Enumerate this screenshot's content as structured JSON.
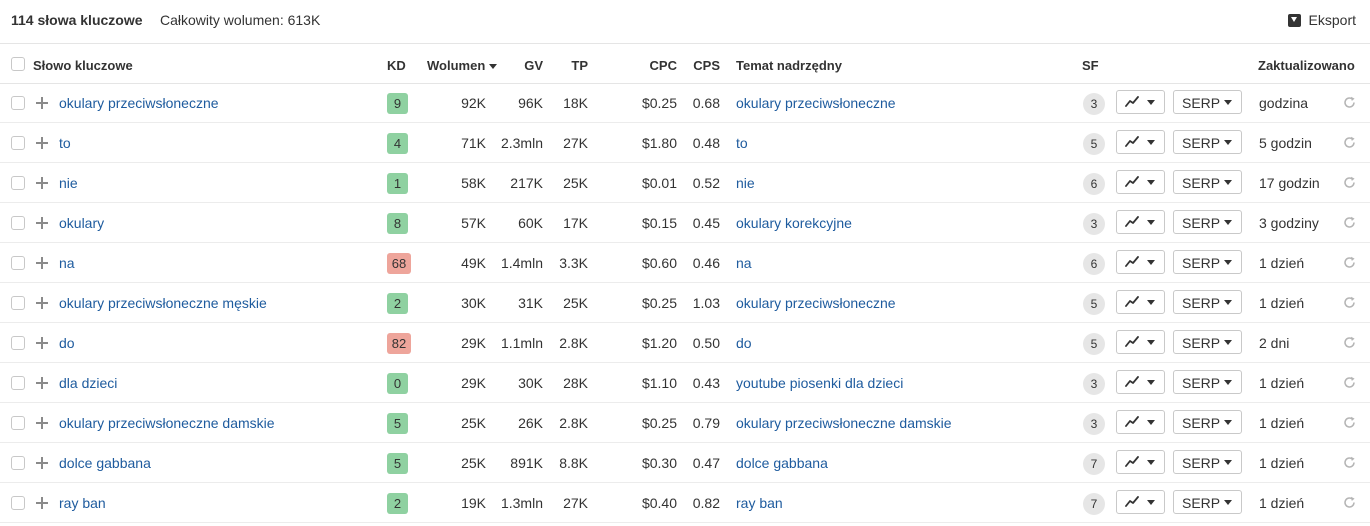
{
  "header": {
    "title": "114 słowa kluczowe",
    "volume": "Całkowity wolumen: 613K",
    "export_label": "Eksport"
  },
  "columns": {
    "keyword": "Słowo kluczowe",
    "kd": "KD",
    "volume": "Wolumen",
    "gv": "GV",
    "tp": "TP",
    "cpc": "CPC",
    "cps": "CPS",
    "parent": "Temat nadrzędny",
    "sf": "SF",
    "updated": "Zaktualizowano"
  },
  "serp_label": "SERP",
  "colors": {
    "link": "#1e5b9e",
    "kd_green": "#8fd1a1",
    "kd_red": "#eea59b"
  },
  "rows": [
    {
      "keyword": "okulary przeciwsłoneczne",
      "kd": "9",
      "kd_color": "green",
      "volume": "92K",
      "gv": "96K",
      "tp": "18K",
      "cpc": "$0.25",
      "cps": "0.68",
      "parent": "okulary przeciwsłoneczne",
      "sf": "3",
      "updated": "godzina"
    },
    {
      "keyword": "to",
      "kd": "4",
      "kd_color": "green",
      "volume": "71K",
      "gv": "2.3mln",
      "tp": "27K",
      "cpc": "$1.80",
      "cps": "0.48",
      "parent": "to",
      "sf": "5",
      "updated": "5 godzin"
    },
    {
      "keyword": "nie",
      "kd": "1",
      "kd_color": "green",
      "volume": "58K",
      "gv": "217K",
      "tp": "25K",
      "cpc": "$0.01",
      "cps": "0.52",
      "parent": "nie",
      "sf": "6",
      "updated": "17 godzin"
    },
    {
      "keyword": "okulary",
      "kd": "8",
      "kd_color": "green",
      "volume": "57K",
      "gv": "60K",
      "tp": "17K",
      "cpc": "$0.15",
      "cps": "0.45",
      "parent": "okulary korekcyjne",
      "sf": "3",
      "updated": "3 godziny"
    },
    {
      "keyword": "na",
      "kd": "68",
      "kd_color": "red",
      "volume": "49K",
      "gv": "1.4mln",
      "tp": "3.3K",
      "cpc": "$0.60",
      "cps": "0.46",
      "parent": "na",
      "sf": "6",
      "updated": "1 dzień"
    },
    {
      "keyword": "okulary przeciwsłoneczne męskie",
      "kd": "2",
      "kd_color": "green",
      "volume": "30K",
      "gv": "31K",
      "tp": "25K",
      "cpc": "$0.25",
      "cps": "1.03",
      "parent": "okulary przeciwsłoneczne",
      "sf": "5",
      "updated": "1 dzień"
    },
    {
      "keyword": "do",
      "kd": "82",
      "kd_color": "red",
      "volume": "29K",
      "gv": "1.1mln",
      "tp": "2.8K",
      "cpc": "$1.20",
      "cps": "0.50",
      "parent": "do",
      "sf": "5",
      "updated": "2 dni"
    },
    {
      "keyword": "dla dzieci",
      "kd": "0",
      "kd_color": "green",
      "volume": "29K",
      "gv": "30K",
      "tp": "28K",
      "cpc": "$1.10",
      "cps": "0.43",
      "parent": "youtube piosenki dla dzieci",
      "sf": "3",
      "updated": "1 dzień"
    },
    {
      "keyword": "okulary przeciwsłoneczne damskie",
      "kd": "5",
      "kd_color": "green",
      "volume": "25K",
      "gv": "26K",
      "tp": "2.8K",
      "cpc": "$0.25",
      "cps": "0.79",
      "parent": "okulary przeciwsłoneczne damskie",
      "sf": "3",
      "updated": "1 dzień"
    },
    {
      "keyword": "dolce gabbana",
      "kd": "5",
      "kd_color": "green",
      "volume": "25K",
      "gv": "891K",
      "tp": "8.8K",
      "cpc": "$0.30",
      "cps": "0.47",
      "parent": "dolce gabbana",
      "sf": "7",
      "updated": "1 dzień"
    },
    {
      "keyword": "ray ban",
      "kd": "2",
      "kd_color": "green",
      "volume": "19K",
      "gv": "1.3mln",
      "tp": "27K",
      "cpc": "$0.40",
      "cps": "0.82",
      "parent": "ray ban",
      "sf": "7",
      "updated": "1 dzień"
    }
  ]
}
